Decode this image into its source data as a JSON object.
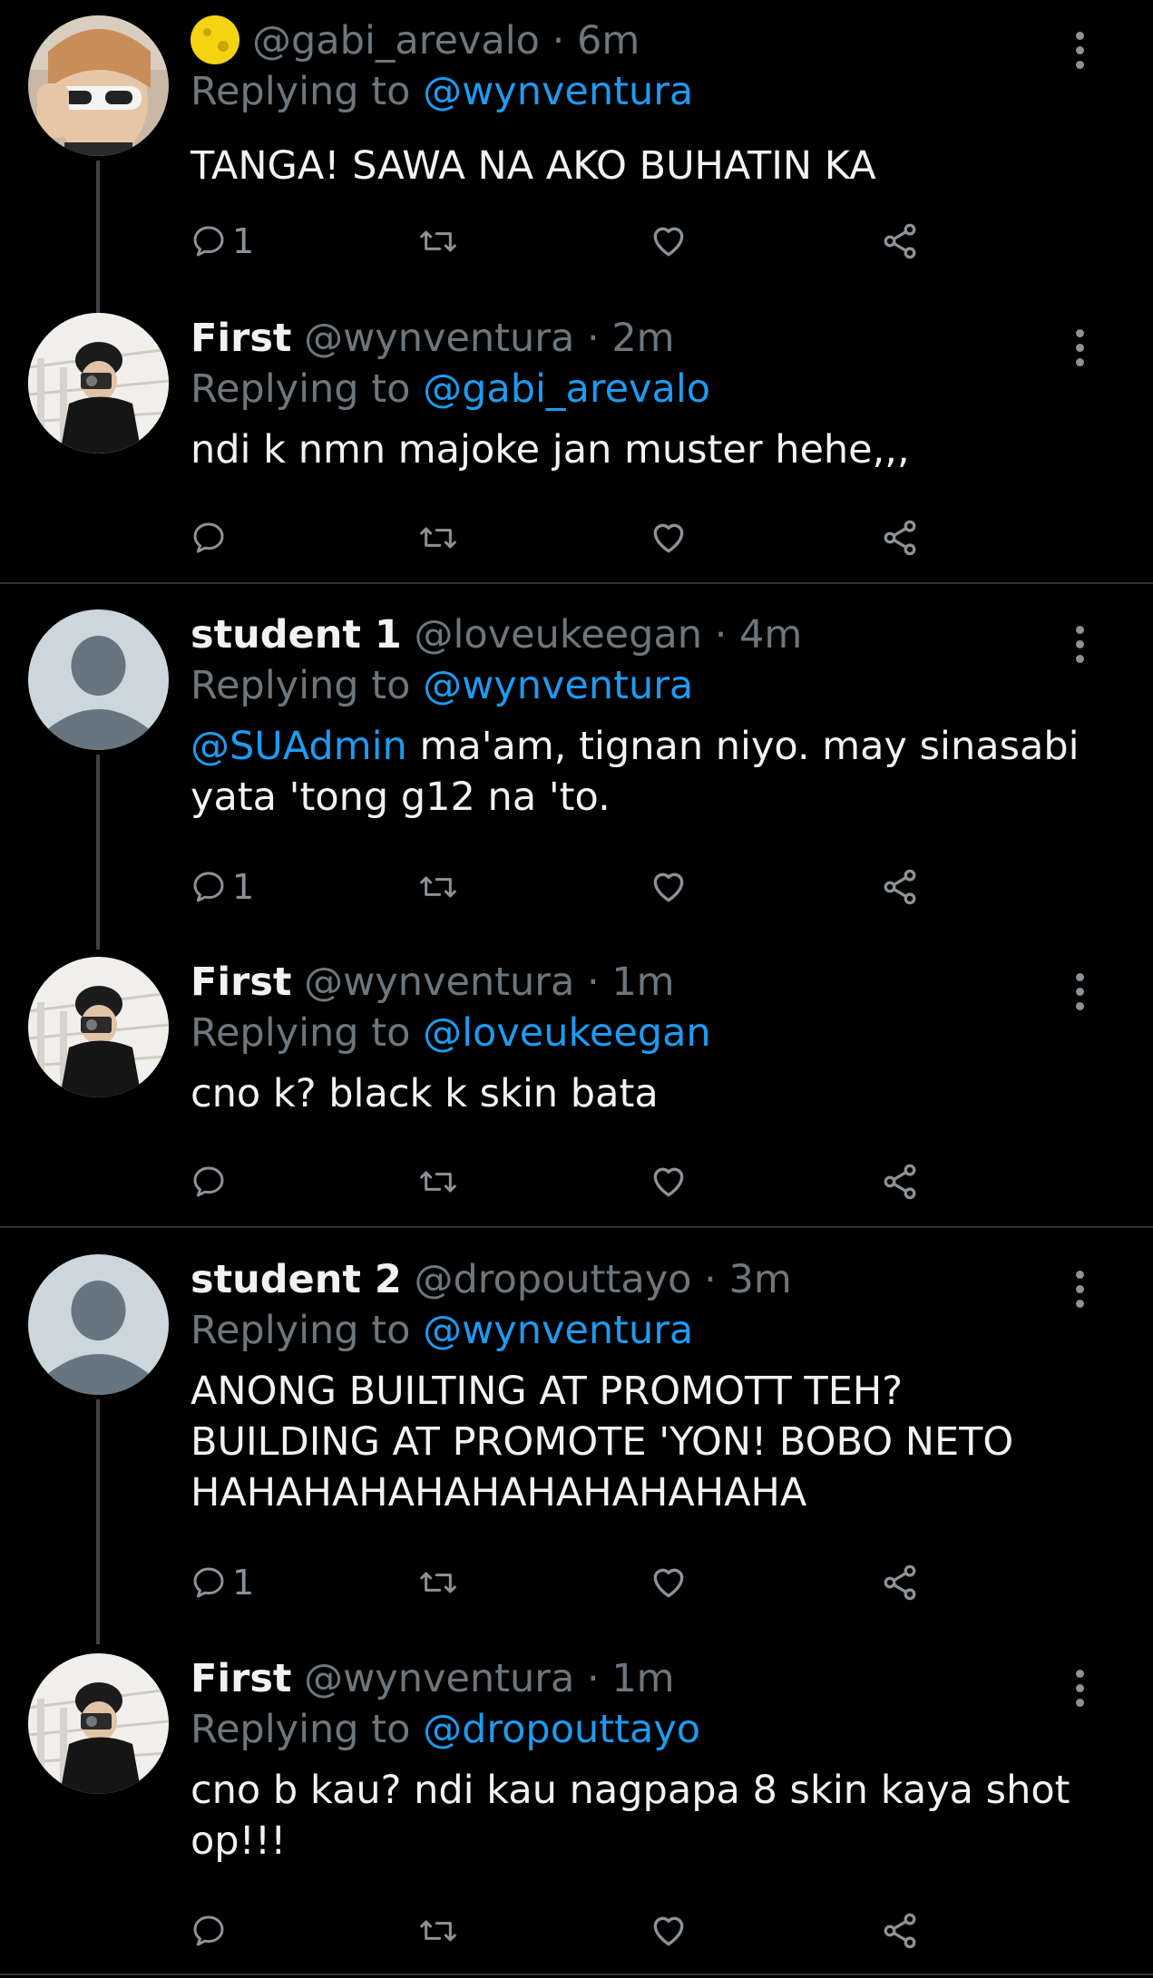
{
  "tweets": [
    {
      "name": "",
      "handle": "@gabi_arevalo",
      "sep": "·",
      "time": "6m",
      "replying_prefix": "Replying to ",
      "replying_handle": "@wynventura",
      "mention": "",
      "text_lines": [
        "TANGA! SAWA NA AKO BUHATIN KA"
      ],
      "reply_count": "1",
      "avatar": "photo-sunglasses",
      "emoji": "moon-emoji"
    },
    {
      "name": "First",
      "handle": "@wynventura",
      "sep": "·",
      "time": "2m",
      "replying_prefix": "Replying to ",
      "replying_handle": "@gabi_arevalo",
      "mention": "",
      "text_lines": [
        "ndi k nmn majoke jan muster hehe,,,"
      ],
      "reply_count": "",
      "avatar": "photo-camera"
    },
    {
      "name": "student 1",
      "handle": "@loveukeegan",
      "sep": "·",
      "time": "4m",
      "replying_prefix": "Replying to ",
      "replying_handle": "@wynventura",
      "mention": "@SUAdmin",
      "text_lines": [
        " ma'am, tignan niyo. may sinasabi",
        "yata 'tong g12 na 'to."
      ],
      "reply_count": "1",
      "avatar": "default-avatar"
    },
    {
      "name": "First",
      "handle": "@wynventura",
      "sep": "·",
      "time": "1m",
      "replying_prefix": "Replying to ",
      "replying_handle": "@loveukeegan",
      "mention": "",
      "text_lines": [
        "cno k? black k skin bata"
      ],
      "reply_count": "",
      "avatar": "photo-camera"
    },
    {
      "name": "student 2",
      "handle": "@dropouttayo",
      "sep": "·",
      "time": "3m",
      "replying_prefix": "Replying to ",
      "replying_handle": "@wynventura",
      "mention": "",
      "text_lines": [
        "ANONG BUILTING AT PROMOTT TEH?",
        "BUILDING AT PROMOTE 'YON! BOBO NETO",
        "HAHAHAHAHAHAHAHAHAHAHA"
      ],
      "reply_count": "1",
      "avatar": "default-avatar"
    },
    {
      "name": "First",
      "handle": "@wynventura",
      "sep": "·",
      "time": "1m",
      "replying_prefix": "Replying to ",
      "replying_handle": "@dropouttayo",
      "mention": "",
      "text_lines": [
        "cno b kau? ndi kau nagpapa 8 skin kaya shot",
        "op!!!"
      ],
      "reply_count": "",
      "avatar": "photo-camera"
    }
  ],
  "icons": {
    "reply": "reply-icon",
    "retweet": "retweet-icon",
    "like": "heart-icon",
    "share": "share-icon",
    "more": "more-vertical-icon"
  },
  "colors": {
    "background": "#000000",
    "text": "#f2f2f2",
    "muted": "#6e767d",
    "link": "#1d9bf0",
    "divider": "#2f3336"
  }
}
